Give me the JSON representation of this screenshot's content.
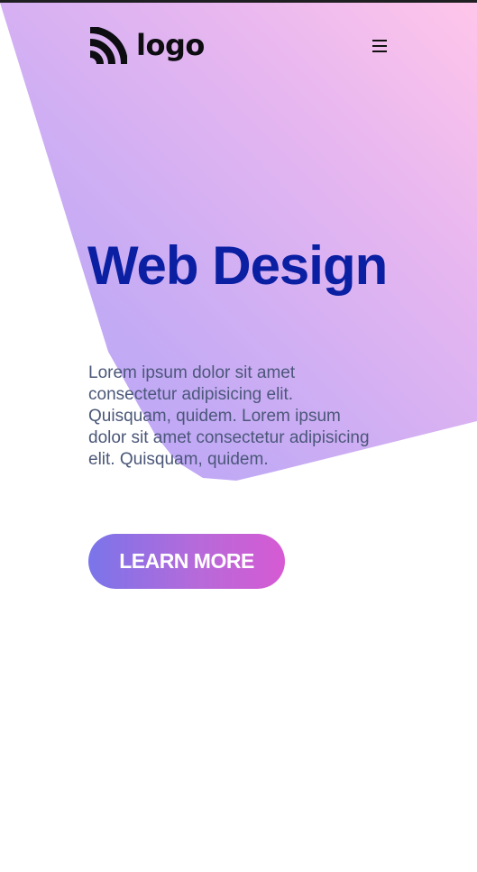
{
  "header": {
    "logo_text": "logo",
    "logo_icon": "rss-feed-icon",
    "menu_icon": "hamburger-menu-icon"
  },
  "hero": {
    "title": "Web Design",
    "description": "Lorem ipsum dolor sit amet consectetur adipisicing elit. Quisquam, quidem. Lorem ipsum dolor sit amet consectetur adipisicing elit. Quisquam, quidem.",
    "cta_label": "LEARN MORE"
  },
  "colors": {
    "title": "#0b1fa3",
    "body_text": "#4b5779",
    "gradient_pink": "#ffc6ea",
    "gradient_violet": "#b9a4f7",
    "button_start": "#7a74ea",
    "button_end": "#d65ad3"
  }
}
